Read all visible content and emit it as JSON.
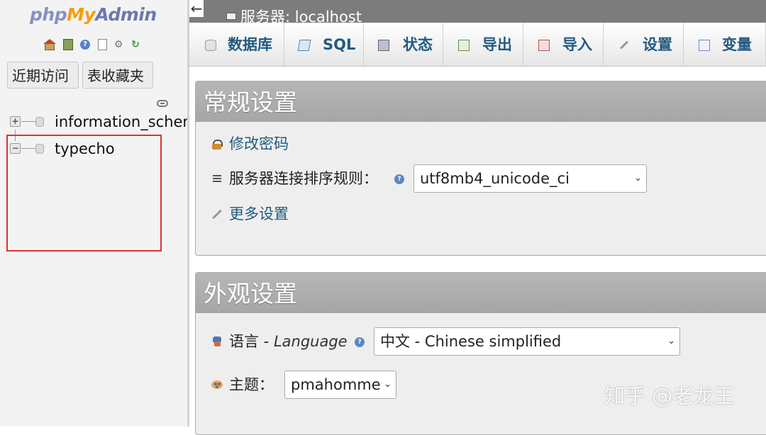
{
  "logo": {
    "php": "php",
    "my": "My",
    "admin": "Admin"
  },
  "nav": {
    "quick_icons": [
      "home-icon",
      "exit-icon",
      "help-icon",
      "docs-icon",
      "settings-icon",
      "reload-icon"
    ],
    "tabs": {
      "recent": "近期访问",
      "favorites": "表收藏夹"
    },
    "databases": [
      {
        "name": "information_schema",
        "expanded": false
      },
      {
        "name": "typecho",
        "expanded": true
      }
    ]
  },
  "server": {
    "label": "服务器: localhost"
  },
  "menu": [
    {
      "label": "数据库",
      "icon": "database-icon"
    },
    {
      "label": "SQL",
      "icon": "sql-icon"
    },
    {
      "label": "状态",
      "icon": "status-icon"
    },
    {
      "label": "导出",
      "icon": "export-icon"
    },
    {
      "label": "导入",
      "icon": "import-icon"
    },
    {
      "label": "设置",
      "icon": "wrench-icon"
    },
    {
      "label": "变量",
      "icon": "variables-icon"
    }
  ],
  "general": {
    "title": "常规设置",
    "change_password": "修改密码",
    "collation_label": "服务器连接排序规则：",
    "collation_value": "utf8mb4_unicode_ci",
    "more_settings": "更多设置"
  },
  "appearance": {
    "title": "外观设置",
    "language_label_cn": "语言 - ",
    "language_label_en": "Language",
    "language_value": "中文 - Chinese simplified",
    "theme_label": "主题：",
    "theme_value": "pmahomme"
  },
  "watermark": "知乎 @老龙王",
  "colors": {
    "link": "#235a81",
    "highlight_box": "#e03030",
    "server_bar": "#7c7c7c",
    "panel_head": "#aaaaaa"
  }
}
